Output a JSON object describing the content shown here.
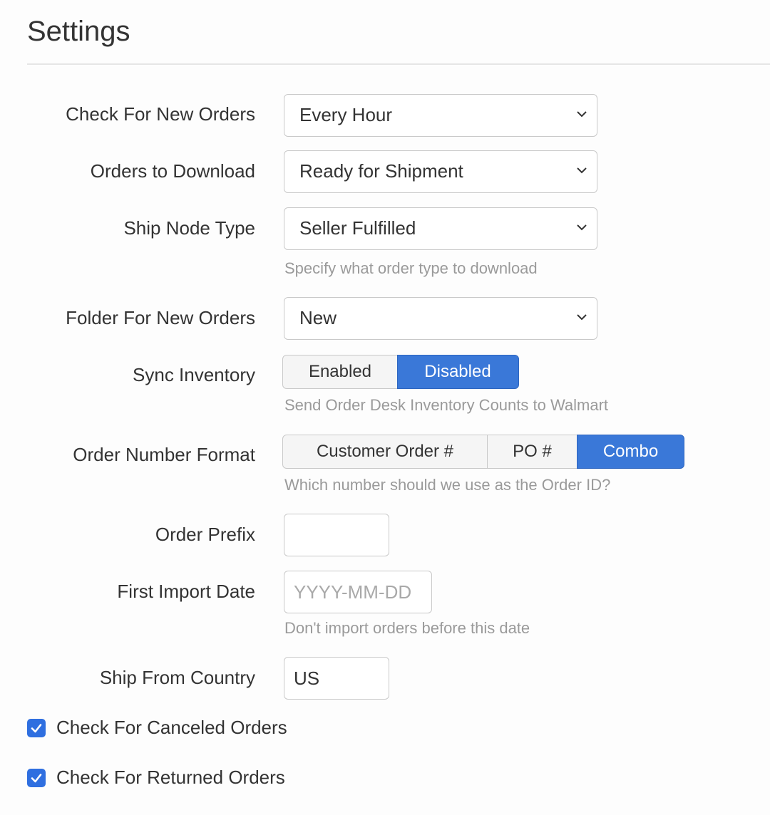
{
  "page": {
    "title": "Settings"
  },
  "form": {
    "check_new_orders": {
      "label": "Check For New Orders",
      "value": "Every Hour"
    },
    "orders_to_download": {
      "label": "Orders to Download",
      "value": "Ready for Shipment"
    },
    "ship_node_type": {
      "label": "Ship Node Type",
      "value": "Seller Fulfilled",
      "help": "Specify what order type to download"
    },
    "folder_new_orders": {
      "label": "Folder For New Orders",
      "value": "New"
    },
    "sync_inventory": {
      "label": "Sync Inventory",
      "options": [
        "Enabled",
        "Disabled"
      ],
      "selected": "Disabled",
      "help": "Send Order Desk Inventory Counts to Walmart"
    },
    "order_number_format": {
      "label": "Order Number Format",
      "options": [
        "Customer Order #",
        "PO #",
        "Combo"
      ],
      "selected": "Combo",
      "help": "Which number should we use as the Order ID?"
    },
    "order_prefix": {
      "label": "Order Prefix",
      "value": ""
    },
    "first_import_date": {
      "label": "First Import Date",
      "placeholder": "YYYY-MM-DD",
      "help": "Don't import orders before this date"
    },
    "ship_from_country": {
      "label": "Ship From Country",
      "value": "US"
    },
    "check_canceled": {
      "label": "Check For Canceled Orders",
      "checked": true
    },
    "check_returned": {
      "label": "Check For Returned Orders",
      "checked": true
    }
  },
  "colors": {
    "accent": "#3a78d8",
    "checkbox": "#2f6fe0",
    "help_text": "#9a9a9a"
  },
  "icons": {
    "select_arrow": "chevron-down-icon",
    "checkbox_mark": "checkmark-icon"
  }
}
